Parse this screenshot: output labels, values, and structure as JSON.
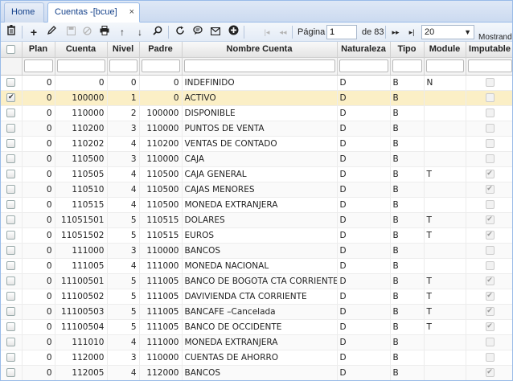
{
  "tabs": [
    {
      "label": "Home",
      "active": false
    },
    {
      "label": "Cuentas -[bcue]",
      "active": true,
      "close": "×"
    }
  ],
  "toolbar": {
    "icons": [
      "trash-icon",
      "add-icon",
      "edit-icon",
      "save-icon",
      "cancel-icon",
      "print-icon",
      "upload-icon",
      "download-icon",
      "search-icon",
      "refresh-icon",
      "comment-icon",
      "mail-icon",
      "add-circle-icon"
    ],
    "pagination": {
      "first": "|◂",
      "prev": "◂◂",
      "page_label": "Página",
      "page_value": "1",
      "of_label": "de 83",
      "next": "▸▸",
      "last": "▸|",
      "page_size": "20",
      "showing_label": "Mostrand"
    }
  },
  "columns": [
    "Plan",
    "Cuenta",
    "Nivel",
    "Padre",
    "Nombre Cuenta",
    "Naturaleza",
    "Tipo",
    "Module",
    "Imputable"
  ],
  "rows": [
    {
      "plan": "0",
      "cuenta": "0",
      "nivel": "0",
      "padre": "0",
      "nombre": "INDEFINIDO",
      "naturaleza": "D",
      "tipo": "B",
      "module": "N",
      "imputable": false,
      "selected": false
    },
    {
      "plan": "0",
      "cuenta": "100000",
      "nivel": "1",
      "padre": "0",
      "nombre": "ACTIVO",
      "naturaleza": "D",
      "tipo": "B",
      "module": "",
      "imputable": false,
      "selected": true
    },
    {
      "plan": "0",
      "cuenta": "110000",
      "nivel": "2",
      "padre": "100000",
      "nombre": "DISPONIBLE",
      "naturaleza": "D",
      "tipo": "B",
      "module": "",
      "imputable": false,
      "selected": false
    },
    {
      "plan": "0",
      "cuenta": "110200",
      "nivel": "3",
      "padre": "110000",
      "nombre": "PUNTOS DE VENTA",
      "naturaleza": "D",
      "tipo": "B",
      "module": "",
      "imputable": false,
      "selected": false
    },
    {
      "plan": "0",
      "cuenta": "110202",
      "nivel": "4",
      "padre": "110200",
      "nombre": "VENTAS DE CONTADO",
      "naturaleza": "D",
      "tipo": "B",
      "module": "",
      "imputable": false,
      "selected": false
    },
    {
      "plan": "0",
      "cuenta": "110500",
      "nivel": "3",
      "padre": "110000",
      "nombre": "CAJA",
      "naturaleza": "D",
      "tipo": "B",
      "module": "",
      "imputable": false,
      "selected": false
    },
    {
      "plan": "0",
      "cuenta": "110505",
      "nivel": "4",
      "padre": "110500",
      "nombre": "CAJA GENERAL",
      "naturaleza": "D",
      "tipo": "B",
      "module": "T",
      "imputable": true,
      "selected": false
    },
    {
      "plan": "0",
      "cuenta": "110510",
      "nivel": "4",
      "padre": "110500",
      "nombre": "CAJAS MENORES",
      "naturaleza": "D",
      "tipo": "B",
      "module": "",
      "imputable": true,
      "selected": false
    },
    {
      "plan": "0",
      "cuenta": "110515",
      "nivel": "4",
      "padre": "110500",
      "nombre": "MONEDA EXTRANJERA",
      "naturaleza": "D",
      "tipo": "B",
      "module": "",
      "imputable": false,
      "selected": false
    },
    {
      "plan": "0",
      "cuenta": "11051501",
      "nivel": "5",
      "padre": "110515",
      "nombre": "DOLARES",
      "naturaleza": "D",
      "tipo": "B",
      "module": "T",
      "imputable": true,
      "selected": false
    },
    {
      "plan": "0",
      "cuenta": "11051502",
      "nivel": "5",
      "padre": "110515",
      "nombre": "EUROS",
      "naturaleza": "D",
      "tipo": "B",
      "module": "T",
      "imputable": true,
      "selected": false
    },
    {
      "plan": "0",
      "cuenta": "111000",
      "nivel": "3",
      "padre": "110000",
      "nombre": "BANCOS",
      "naturaleza": "D",
      "tipo": "B",
      "module": "",
      "imputable": false,
      "selected": false
    },
    {
      "plan": "0",
      "cuenta": "111005",
      "nivel": "4",
      "padre": "111000",
      "nombre": "MONEDA NACIONAL",
      "naturaleza": "D",
      "tipo": "B",
      "module": "",
      "imputable": false,
      "selected": false
    },
    {
      "plan": "0",
      "cuenta": "11100501",
      "nivel": "5",
      "padre": "111005",
      "nombre": "BANCO DE BOGOTA CTA CORRIENTE",
      "naturaleza": "D",
      "tipo": "B",
      "module": "T",
      "imputable": true,
      "selected": false
    },
    {
      "plan": "0",
      "cuenta": "11100502",
      "nivel": "5",
      "padre": "111005",
      "nombre": "DAVIVIENDA CTA CORRIENTE",
      "naturaleza": "D",
      "tipo": "B",
      "module": "T",
      "imputable": true,
      "selected": false
    },
    {
      "plan": "0",
      "cuenta": "11100503",
      "nivel": "5",
      "padre": "111005",
      "nombre": "BANCAFE –Cancelada",
      "naturaleza": "D",
      "tipo": "B",
      "module": "T",
      "imputable": true,
      "selected": false
    },
    {
      "plan": "0",
      "cuenta": "11100504",
      "nivel": "5",
      "padre": "111005",
      "nombre": "BANCO DE OCCIDENTE",
      "naturaleza": "D",
      "tipo": "B",
      "module": "T",
      "imputable": true,
      "selected": false
    },
    {
      "plan": "0",
      "cuenta": "111010",
      "nivel": "4",
      "padre": "111000",
      "nombre": "MONEDA EXTRANJERA",
      "naturaleza": "D",
      "tipo": "B",
      "module": "",
      "imputable": false,
      "selected": false
    },
    {
      "plan": "0",
      "cuenta": "112000",
      "nivel": "3",
      "padre": "110000",
      "nombre": "CUENTAS DE AHORRO",
      "naturaleza": "D",
      "tipo": "B",
      "module": "",
      "imputable": false,
      "selected": false
    },
    {
      "plan": "0",
      "cuenta": "112005",
      "nivel": "4",
      "padre": "112000",
      "nombre": "BANCOS",
      "naturaleza": "D",
      "tipo": "B",
      "module": "",
      "imputable": true,
      "selected": false
    }
  ]
}
